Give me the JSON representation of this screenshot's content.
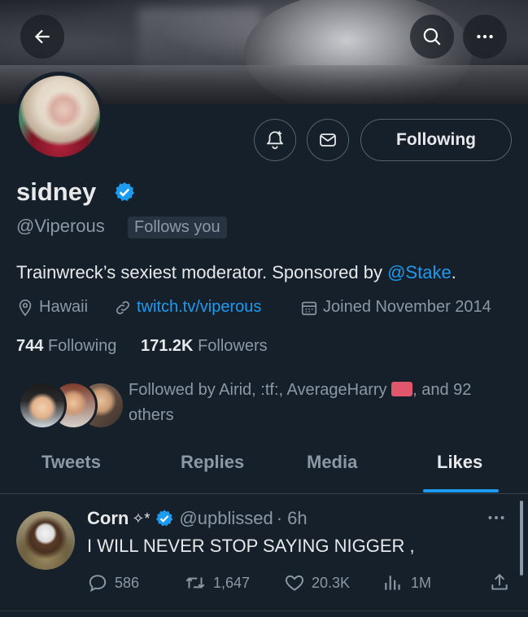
{
  "profile": {
    "name": "sidney",
    "handle": "@Viperous",
    "follows_you": "Follows you",
    "follow_button": "Following",
    "bio_text": "Trainwreck’s sexiest moderator. Sponsored by ",
    "bio_mention": "@Stake",
    "bio_end": ".",
    "location": "Hawaii",
    "website": "twitch.tv/viperous",
    "joined": "Joined November 2014",
    "following_count": "744",
    "following_label": "Following",
    "followers_count": "171.2K",
    "followers_label": "Followers",
    "followed_by_text": "Followed by Airid, :tf:, AverageHarry",
    "followed_by_end": ", and 92 others"
  },
  "header_icons": [
    "back-arrow-icon",
    "search-icon",
    "more-icon"
  ],
  "action_icons": [
    "notification-bell-icon",
    "message-icon"
  ],
  "tabs": [
    {
      "label": "Tweets"
    },
    {
      "label": "Replies"
    },
    {
      "label": "Media"
    },
    {
      "label": "Likes"
    }
  ],
  "active_tab": "Likes",
  "tweet": {
    "author": "Corn",
    "author_symbols": "✧*",
    "handle": "@upblissed",
    "time": "· 6h",
    "text": "I WILL NEVER STOP SAYING NIGGER ,",
    "replies": "586",
    "retweets": "1,647",
    "likes": "20.3K",
    "views": "1M"
  },
  "colors": {
    "accent": "#1d9bf0",
    "background": "#15202b",
    "secondary_text": "#8b98a5"
  }
}
